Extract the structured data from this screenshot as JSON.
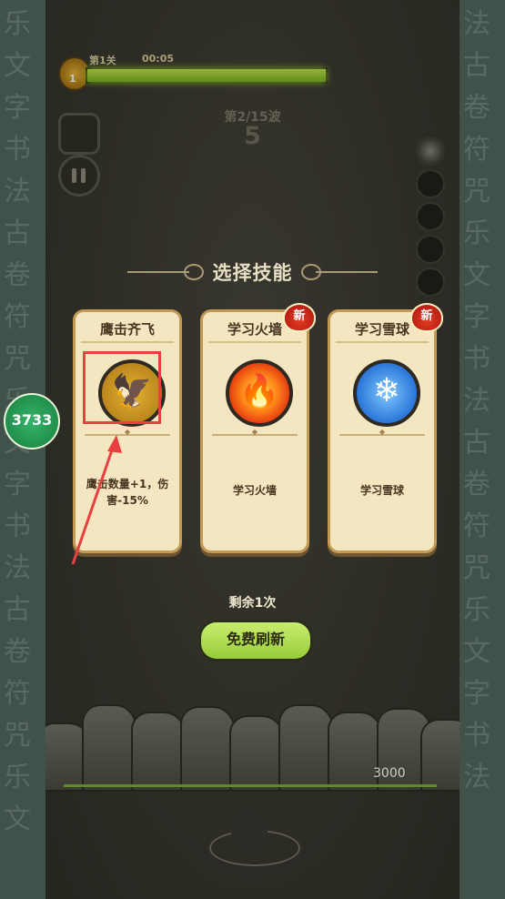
{
  "hud": {
    "level_label": "第1关",
    "timer": "00:05",
    "level_number": "1",
    "hp_fill": 1.0,
    "wave_label": "第2/15波",
    "wave_countdown": "5"
  },
  "dialog": {
    "title": "选择技能",
    "cards": [
      {
        "name": "鹰击齐飞",
        "icon": "eagle-icon",
        "desc": "鹰击数量+1，伤害-15%",
        "is_new": false,
        "new_label": ""
      },
      {
        "name": "学习火墙",
        "icon": "fire-wall-icon",
        "desc": "学习火墙",
        "is_new": true,
        "new_label": "新"
      },
      {
        "name": "学习雪球",
        "icon": "snowball-icon",
        "desc": "学习雪球",
        "is_new": true,
        "new_label": "新"
      }
    ],
    "remaining_label": "剩余1次",
    "refresh_button": "免费刷新"
  },
  "field": {
    "score": "3000"
  },
  "overlay": {
    "coin_count": "3733"
  },
  "colors": {
    "card_bg": "#f4e6c1",
    "refresh_green": "#a7d44a",
    "highlight_red": "#e84040"
  }
}
